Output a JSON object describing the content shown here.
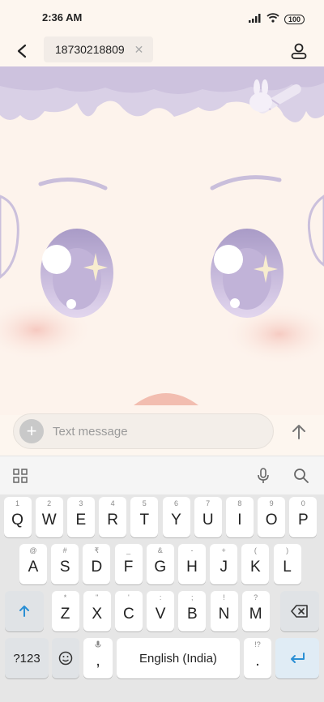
{
  "status_bar": {
    "time": "2:36 AM",
    "battery": "100"
  },
  "header": {
    "recipient": "18730218809"
  },
  "compose": {
    "placeholder": "Text message"
  },
  "keyboard": {
    "row1": [
      {
        "hint": "1",
        "key": "Q"
      },
      {
        "hint": "2",
        "key": "W"
      },
      {
        "hint": "3",
        "key": "E"
      },
      {
        "hint": "4",
        "key": "R"
      },
      {
        "hint": "5",
        "key": "T"
      },
      {
        "hint": "6",
        "key": "Y"
      },
      {
        "hint": "7",
        "key": "U"
      },
      {
        "hint": "8",
        "key": "I"
      },
      {
        "hint": "9",
        "key": "O"
      },
      {
        "hint": "0",
        "key": "P"
      }
    ],
    "row2": [
      {
        "hint": "@",
        "key": "A"
      },
      {
        "hint": "#",
        "key": "S"
      },
      {
        "hint": "₹",
        "key": "D"
      },
      {
        "hint": "_",
        "key": "F"
      },
      {
        "hint": "&",
        "key": "G"
      },
      {
        "hint": "-",
        "key": "H"
      },
      {
        "hint": "+",
        "key": "J"
      },
      {
        "hint": "(",
        "key": "K"
      },
      {
        "hint": ")",
        "key": "L"
      }
    ],
    "row3": [
      {
        "hint": "*",
        "key": "Z"
      },
      {
        "hint": "\"",
        "key": "X"
      },
      {
        "hint": "'",
        "key": "C"
      },
      {
        "hint": ":",
        "key": "V"
      },
      {
        "hint": ";",
        "key": "B"
      },
      {
        "hint": "!",
        "key": "N"
      },
      {
        "hint": "?",
        "key": "M"
      }
    ],
    "symbols_label": "?123",
    "comma": ",",
    "space_label": "English (India)",
    "period_hint": "!?",
    "period": "."
  }
}
